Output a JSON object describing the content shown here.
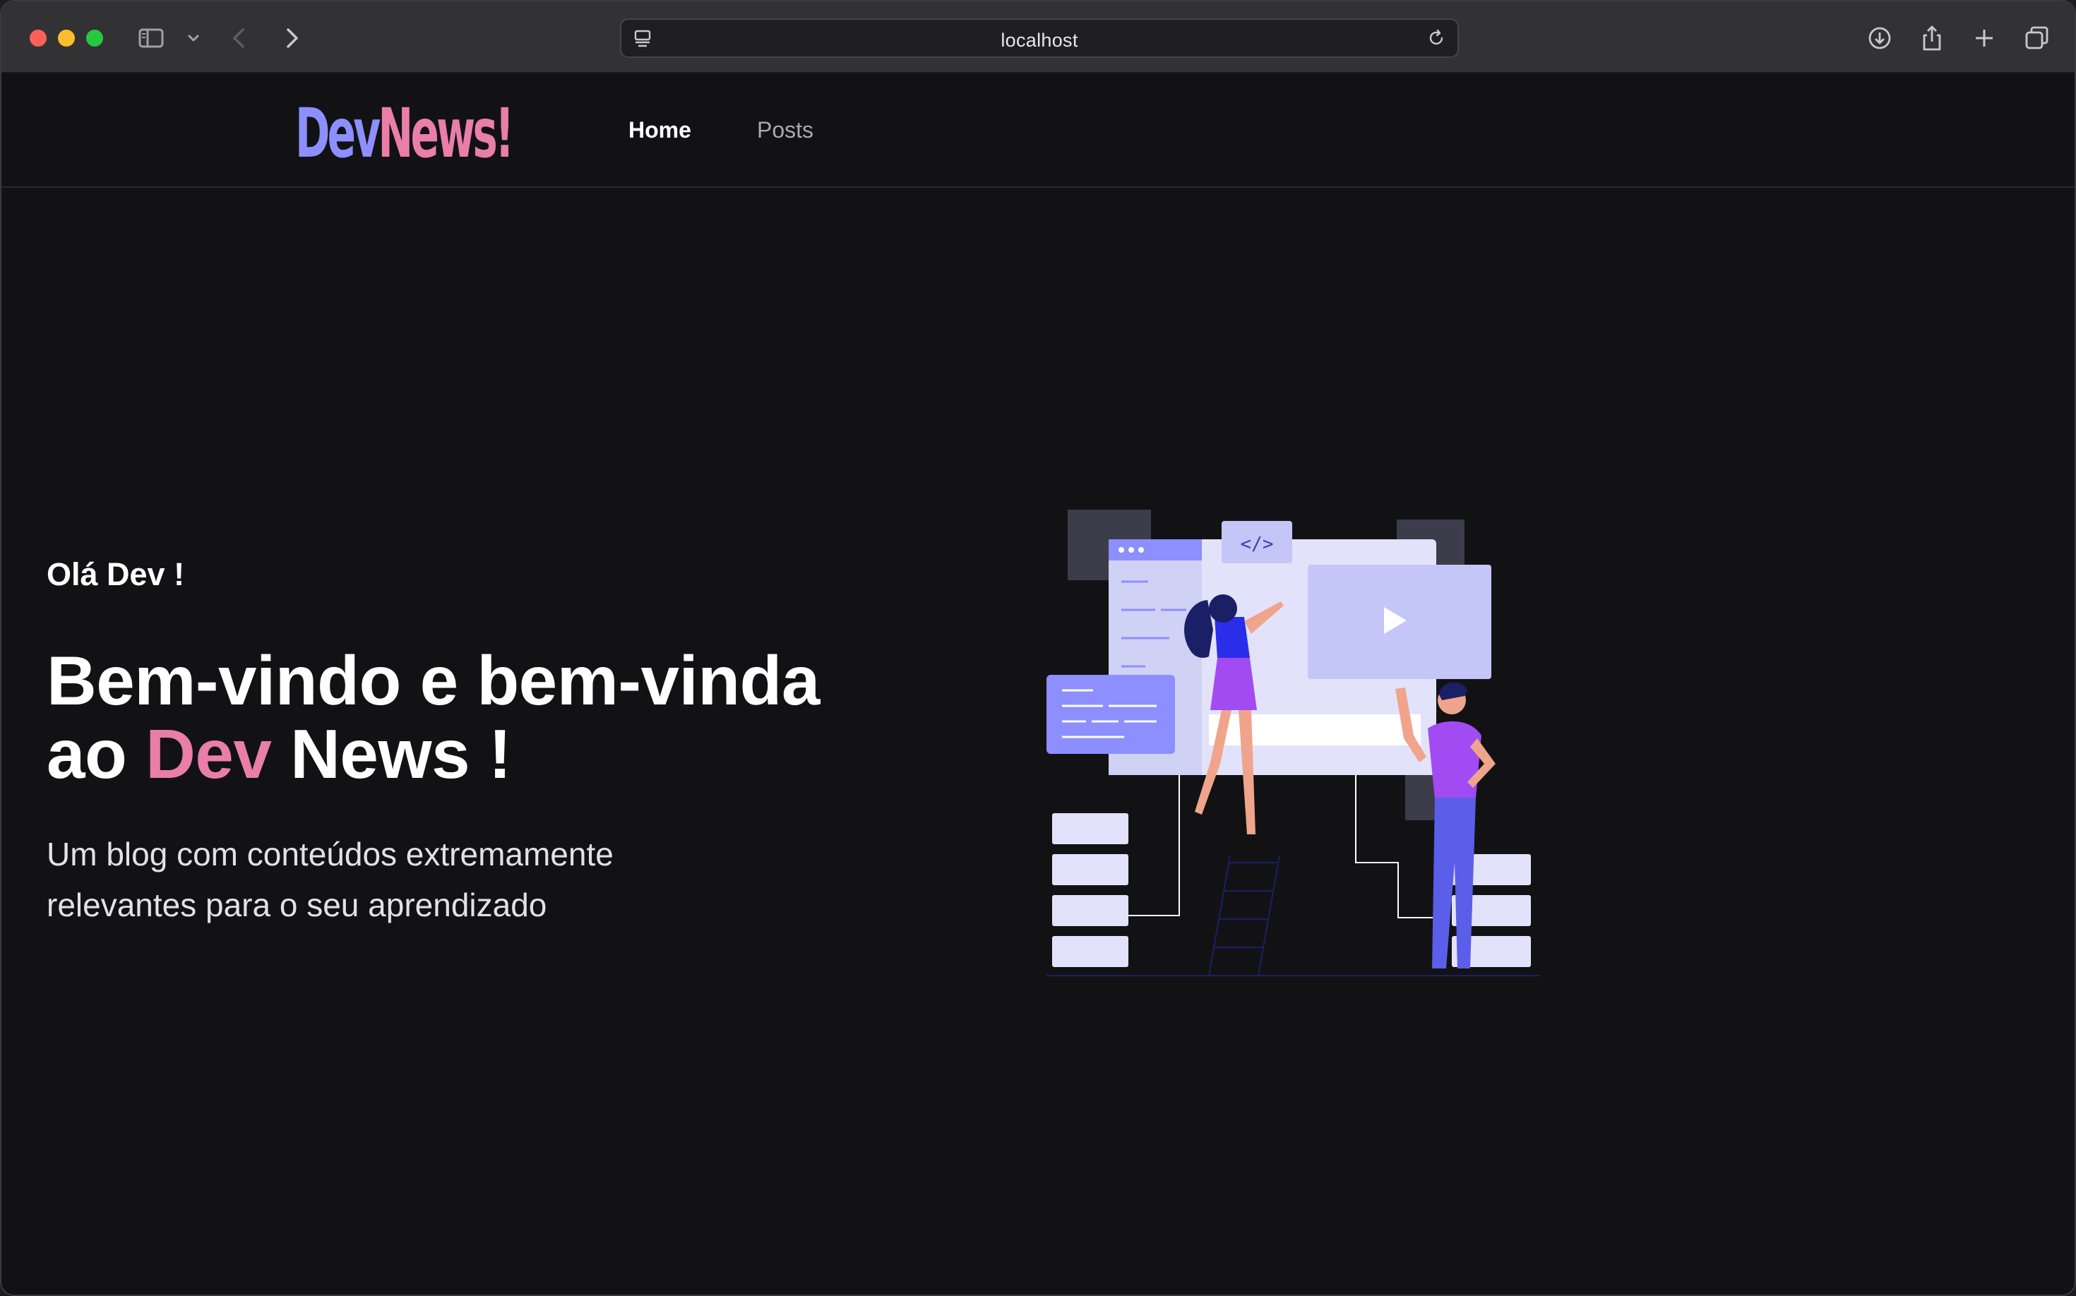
{
  "browser": {
    "url": "localhost",
    "icons": [
      "close-button",
      "minimize-button",
      "zoom-button",
      "sidebar-icon",
      "chevron-down-icon",
      "back-icon",
      "forward-icon",
      "page-menu-icon",
      "reload-icon",
      "download-icon",
      "share-icon",
      "new-tab-icon",
      "tab-overview-icon"
    ]
  },
  "site": {
    "logo": {
      "part1": "Dev",
      "part2": "News!",
      "color1": "#8c8ffd",
      "color2": "#e97ea8"
    },
    "nav": [
      {
        "label": "Home",
        "active": true
      },
      {
        "label": "Posts",
        "active": false
      }
    ]
  },
  "hero": {
    "greeting": "Olá Dev !",
    "headline_line1": "Bem-vindo e bem-vinda",
    "headline_line2_start": "ao",
    "headline_accent": "Dev",
    "headline_line2_end": "News !",
    "subtitle_line1": "Um blog com conteúdos extremamente",
    "subtitle_line2": "relevantes para o seu aprendizado",
    "accent_color": "#e97ea8",
    "illustration": "developers-illustration"
  },
  "colors": {
    "background": "#121214",
    "primary": "#8c8ffd",
    "secondary": "#e97ea8"
  }
}
